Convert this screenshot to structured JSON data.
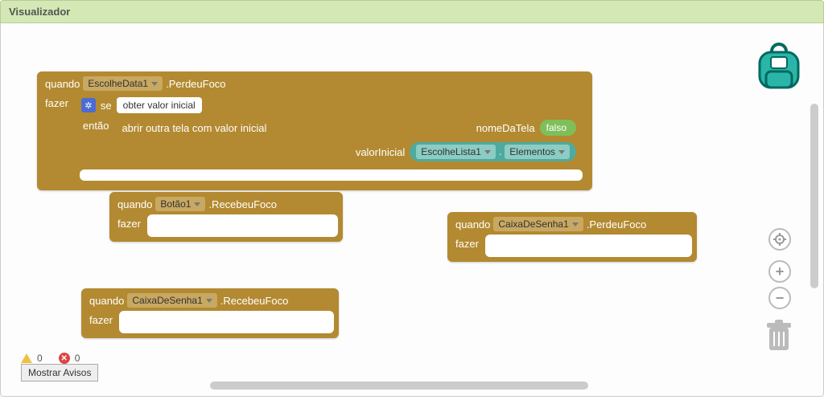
{
  "header": {
    "title": "Visualizador"
  },
  "labels": {
    "quando": "quando",
    "fazer": "fazer",
    "se": "se",
    "entao": "então",
    "obter_valor_inicial": "obter valor inicial",
    "abrir_tela": "abrir outra tela com valor inicial",
    "nomeDaTela": "nomeDaTela",
    "valorInicial": "valorInicial",
    "mostrar_avisos": "Mostrar Avisos"
  },
  "block1": {
    "component": "EscolheData1",
    "event": ".PerdeuFoco",
    "false_val": "falso",
    "teal_component": "EscolheLista1",
    "teal_prop": "Elementos"
  },
  "block2": {
    "component": "Botão1",
    "event": ".RecebeuFoco"
  },
  "block3": {
    "component": "CaixaDeSenha1",
    "event": ".PerdeuFoco"
  },
  "block4": {
    "component": "CaixaDeSenha1",
    "event": ".RecebeuFoco"
  },
  "counts": {
    "warnings": "0",
    "errors": "0"
  }
}
